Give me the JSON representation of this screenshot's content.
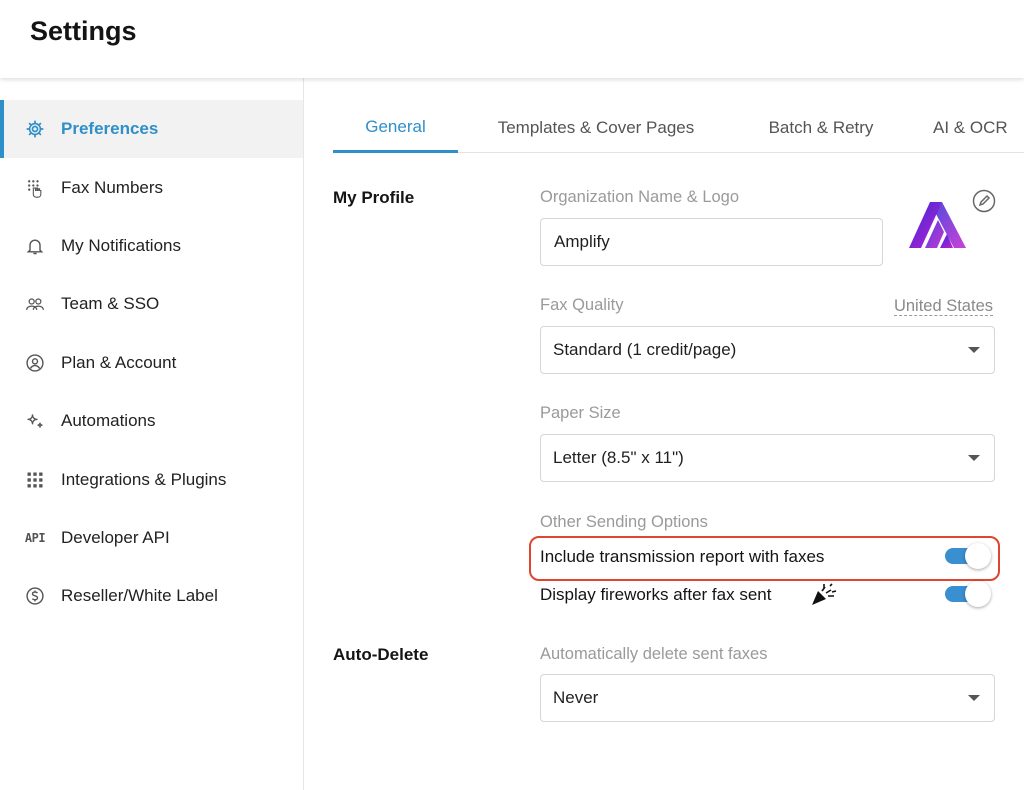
{
  "header": {
    "title": "Settings"
  },
  "sidebar": {
    "items": [
      {
        "label": "Preferences",
        "icon": "gear-icon",
        "active": true
      },
      {
        "label": "Fax Numbers",
        "icon": "keypad-hand-icon"
      },
      {
        "label": "My Notifications",
        "icon": "bell-icon"
      },
      {
        "label": "Team & SSO",
        "icon": "team-icon"
      },
      {
        "label": "Plan & Account",
        "icon": "user-circle-icon"
      },
      {
        "label": "Automations",
        "icon": "sparkle-icon"
      },
      {
        "label": "Integrations & Plugins",
        "icon": "grid-icon"
      },
      {
        "label": "Developer API",
        "icon": "api-icon",
        "icon_text": "API"
      },
      {
        "label": "Reseller/White Label",
        "icon": "dollar-circle-icon"
      }
    ]
  },
  "tabs": [
    {
      "label": "General",
      "active": true
    },
    {
      "label": "Templates & Cover Pages"
    },
    {
      "label": "Batch & Retry"
    },
    {
      "label": "AI & OCR"
    }
  ],
  "profile": {
    "section_title": "My Profile",
    "org_label": "Organization Name & Logo",
    "org_value": "Amplify",
    "fax_quality_label": "Fax Quality",
    "country_link": "United States",
    "fax_quality_value": "Standard (1 credit/page)",
    "paper_size_label": "Paper Size",
    "paper_size_value": "Letter (8.5\" x 11\")",
    "other_options_label": "Other Sending Options",
    "options": [
      {
        "label": "Include transmission report with faxes",
        "enabled": true,
        "highlighted": true
      },
      {
        "label": "Display fireworks after fax sent",
        "enabled": true
      }
    ]
  },
  "auto_delete": {
    "section_title": "Auto-Delete",
    "label": "Automatically delete sent faxes",
    "value": "Never"
  },
  "colors": {
    "accent": "#2f8fc9",
    "toggle_on": "#3a8fd1",
    "highlight": "#e0452f",
    "logo_gradient_start": "#3a2bd8",
    "logo_gradient_end": "#c21fd0"
  }
}
